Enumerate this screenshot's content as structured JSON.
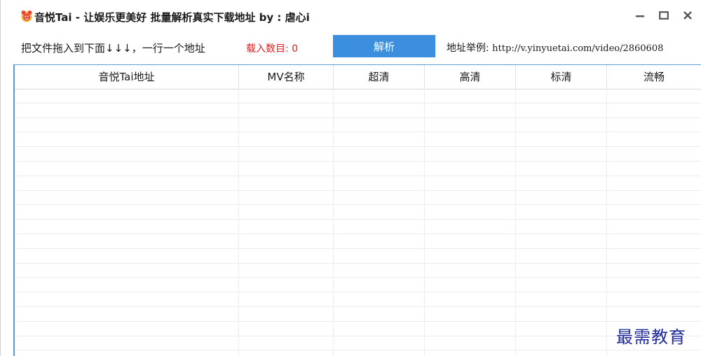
{
  "window": {
    "title": "音悦Tai - 让娱乐更美好   批量解析真实下载地址    by : 虐心i",
    "icon": "app-logo-icon",
    "controls": {
      "minimize_icon": "minimize-icon",
      "maximize_icon": "maximize-icon",
      "close_icon": "close-icon"
    }
  },
  "toolbar": {
    "drag_hint": "把文件拖入到下面↓↓↓，一行一个地址",
    "load_count_label": "载入数目: 0",
    "parse_button_label": "解析",
    "example_label": "地址举例: ",
    "example_url": "http://v.yinyuetai.com/video/2860608"
  },
  "table": {
    "columns": [
      "音悦Tai地址",
      "MV名称",
      "超清",
      "高清",
      "标清",
      "流畅"
    ],
    "rows": []
  },
  "watermark": "最需教育",
  "colors": {
    "accent_button": "#3c8ede",
    "count_text": "#e02020",
    "grid_border": "#5b9bd5",
    "watermark": "#1f2a9c"
  }
}
